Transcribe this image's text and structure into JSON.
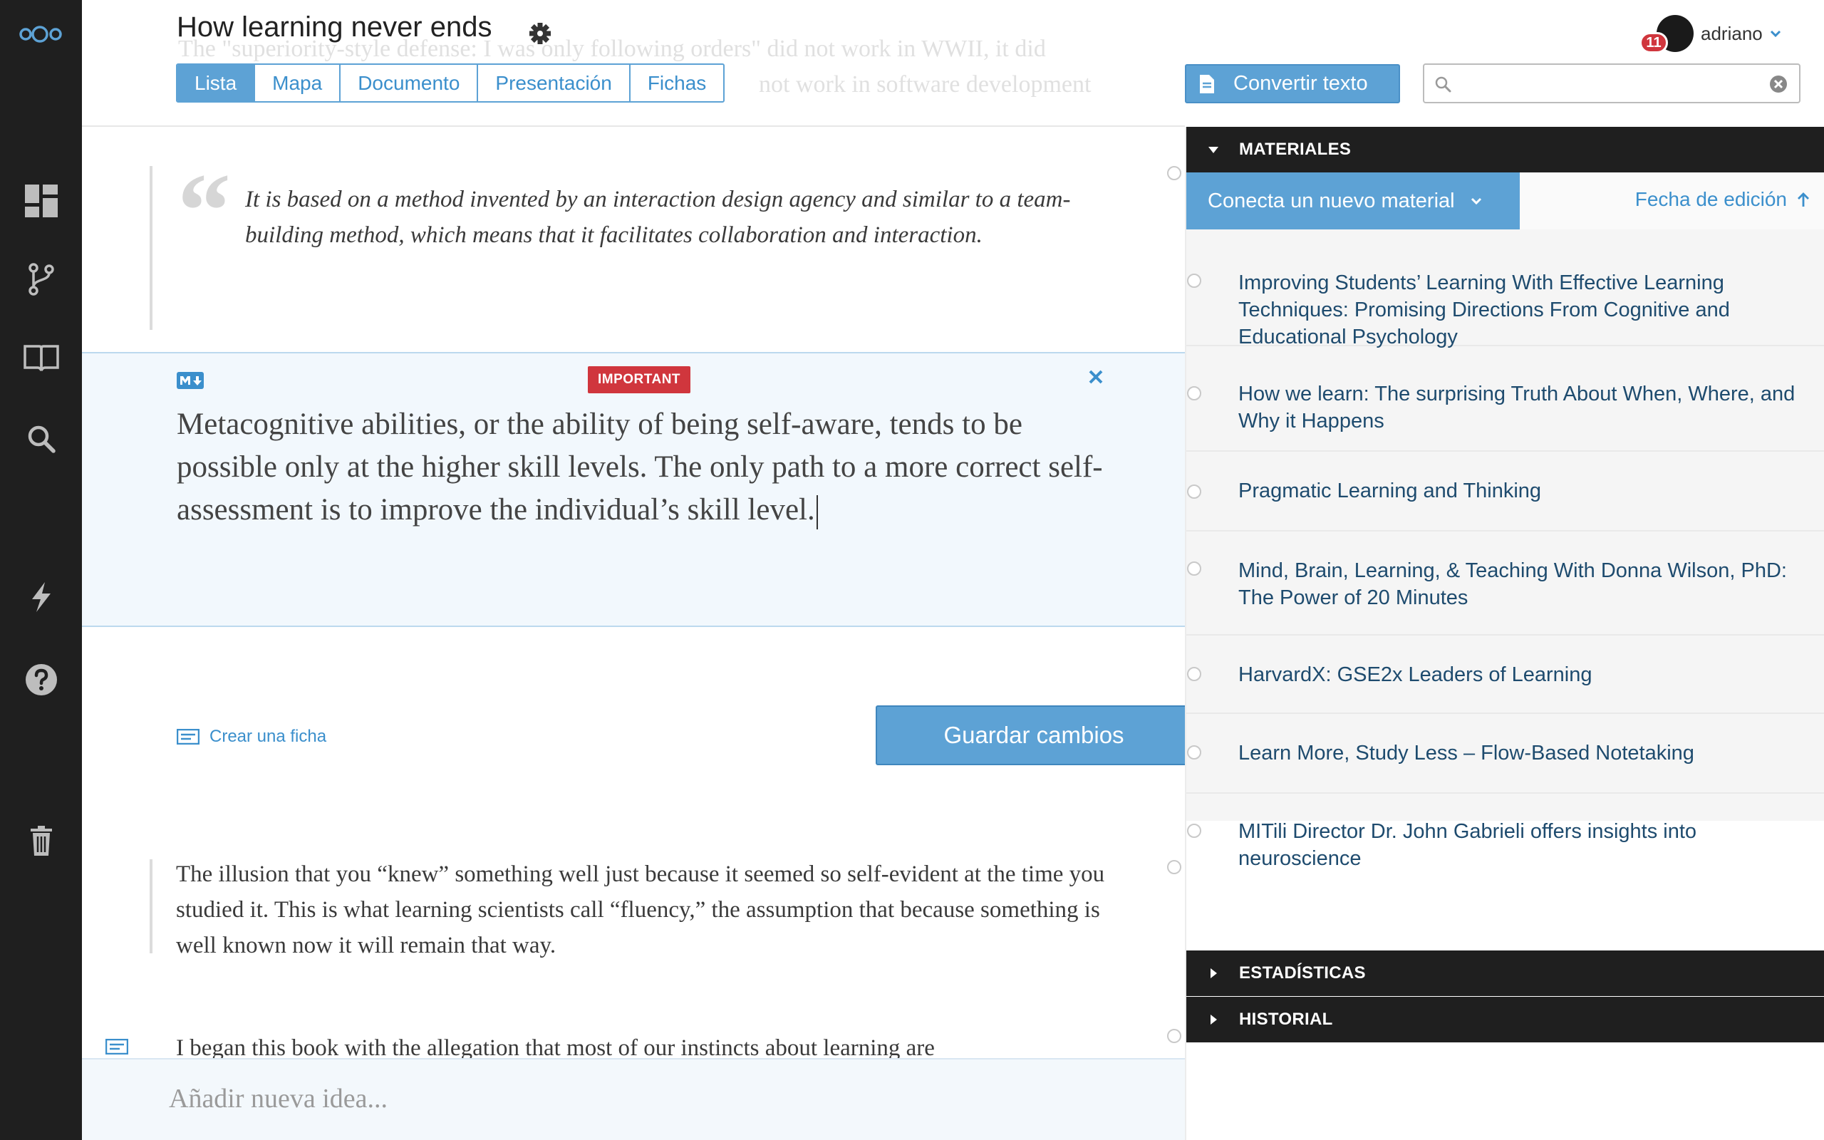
{
  "header": {
    "title": "How learning never ends",
    "ghost_line_1": "The \"superiority-style defense: I was only following orders\" did not work in WWII, it did",
    "ghost_line_2": "not work in software development",
    "tabs": [
      {
        "label": "Lista",
        "active": true
      },
      {
        "label": "Mapa",
        "active": false
      },
      {
        "label": "Documento",
        "active": false
      },
      {
        "label": "Presentación",
        "active": false
      },
      {
        "label": "Fichas",
        "active": false
      }
    ]
  },
  "toolbar": {
    "convert_label": "Convertir texto",
    "search_value": "",
    "search_placeholder": ""
  },
  "user": {
    "name": "adriano",
    "notifications": "11"
  },
  "content": {
    "quote_text": "It is based on a method invented by an interaction design agency and similar to a team-building method, which means that it facilitates collaboration and interaction.",
    "edit_block": {
      "tag": "IMPORTANT",
      "text": "Metacognitive abilities, or the ability of being self-aware, tends to be possible only at the higher skill levels. The only path to a more correct self-assessment is to improve the individual’s skill level.",
      "create_card_label": "Crear una ficha",
      "save_label": "Guardar cambios"
    },
    "paragraph_1": "The illusion that you “knew” something well just because it seemed so self-evident at the time you studied it. This is what learning scientists call “fluency,” the assumption that because something is well known now it will remain that way.",
    "paragraph_2": "I began this book with the allegation that most of our instincts about learning are"
  },
  "footer": {
    "new_idea_placeholder": "Añadir nueva idea..."
  },
  "right_panel": {
    "materials_label": "MATERIALES",
    "connect_label": "Conecta un nuevo material",
    "sort_label": "Fecha de edición",
    "materials": [
      "Improving Students’ Learning With Effective Learning Techniques: Promising Directions From Cognitive and Educational Psychology",
      "How we learn: The surprising Truth About When, Where, and Why it Happens",
      "Pragmatic Learning and Thinking",
      "Mind, Brain, Learning, & Teaching With Donna Wilson, PhD: The Power of 20 Minutes",
      "HarvardX: GSE2x Leaders of Learning",
      "Learn More, Study Less – Flow-Based Notetaking",
      "MITili Director Dr. John Gabrieli offers insights into neuroscience"
    ],
    "stats_label": "ESTADÍSTICAS",
    "history_label": "HISTORIAL"
  },
  "colors": {
    "accent": "#5da2d5",
    "link": "#3b8fcc",
    "sidebar": "#1f1f1f",
    "important": "#d0363d"
  },
  "icons": [
    "logo-icon",
    "dashboard-icon",
    "branch-icon",
    "book-icon",
    "search-icon",
    "lightning-icon",
    "help-icon",
    "trash-icon",
    "gear-icon",
    "document-icon",
    "clear-icon",
    "markdown-icon",
    "close-icon",
    "card-icon",
    "triangle-down-icon",
    "triangle-right-icon",
    "arrow-up-icon",
    "chevron-down-icon"
  ]
}
